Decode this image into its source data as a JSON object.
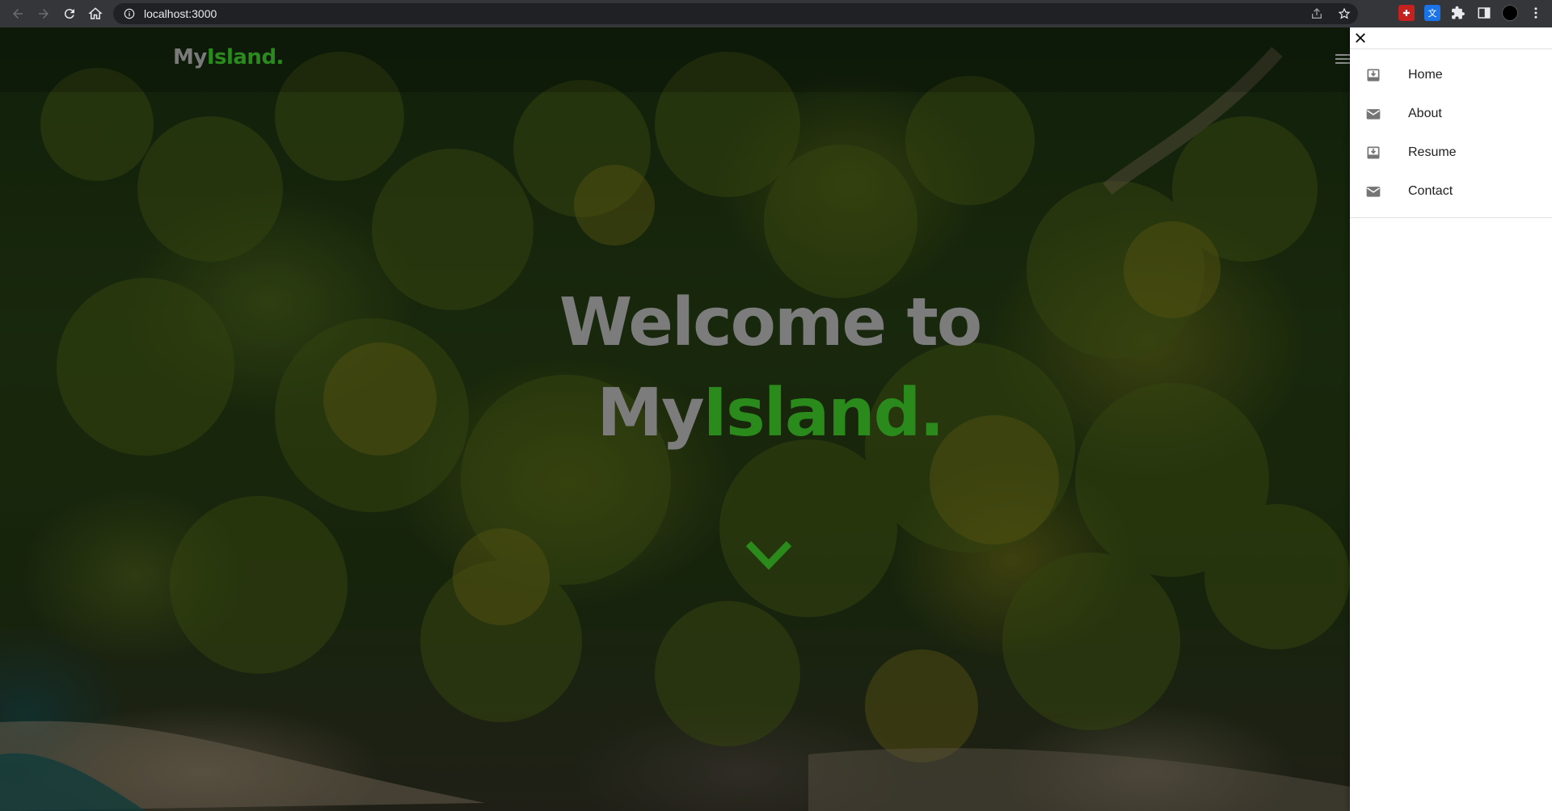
{
  "browser": {
    "url": "localhost:3000"
  },
  "nav": {
    "logo_my": "My",
    "logo_island": "Island."
  },
  "hero": {
    "line1": "Welcome to",
    "line2_my": "My",
    "line2_island": "Island."
  },
  "drawer": {
    "items": [
      {
        "label": "Home",
        "icon": "inbox-download-icon"
      },
      {
        "label": "About",
        "icon": "mail-icon"
      },
      {
        "label": "Resume",
        "icon": "inbox-download-icon"
      },
      {
        "label": "Contact",
        "icon": "mail-icon"
      }
    ]
  },
  "colors": {
    "brand_green": "#2a8a1c",
    "brand_gray": "#7c7c7c"
  }
}
